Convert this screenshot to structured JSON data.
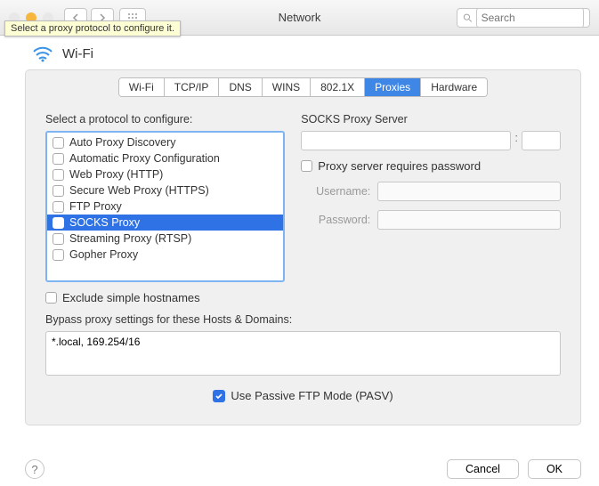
{
  "window": {
    "title": "Network",
    "search_placeholder": "Search",
    "tooltip": "Select a proxy protocol to configure it.",
    "traffic_colors": {
      "close": "#e8e8e8",
      "min": "#f7b63d",
      "max": "#e8e8e8"
    }
  },
  "wifi_header": {
    "label": "Wi-Fi"
  },
  "tabs": [
    "Wi-Fi",
    "TCP/IP",
    "DNS",
    "WINS",
    "802.1X",
    "Proxies",
    "Hardware"
  ],
  "active_tab": "Proxies",
  "left": {
    "label": "Select a protocol to configure:",
    "protocols": [
      {
        "name": "Auto Proxy Discovery",
        "checked": false,
        "selected": false
      },
      {
        "name": "Automatic Proxy Configuration",
        "checked": false,
        "selected": false
      },
      {
        "name": "Web Proxy (HTTP)",
        "checked": false,
        "selected": false
      },
      {
        "name": "Secure Web Proxy (HTTPS)",
        "checked": false,
        "selected": false
      },
      {
        "name": "FTP Proxy",
        "checked": false,
        "selected": false
      },
      {
        "name": "SOCKS Proxy",
        "checked": false,
        "selected": true
      },
      {
        "name": "Streaming Proxy (RTSP)",
        "checked": false,
        "selected": false
      },
      {
        "name": "Gopher Proxy",
        "checked": false,
        "selected": false
      }
    ],
    "exclude_label": "Exclude simple hostnames",
    "exclude_checked": false
  },
  "right": {
    "server_label": "SOCKS Proxy Server",
    "host": "",
    "port": "",
    "requires_password_label": "Proxy server requires password",
    "requires_password": false,
    "username_label": "Username:",
    "username": "",
    "password_label": "Password:",
    "password": ""
  },
  "bypass": {
    "label": "Bypass proxy settings for these Hosts & Domains:",
    "value": "*.local, 169.254/16"
  },
  "pasv": {
    "label": "Use Passive FTP Mode (PASV)",
    "checked": true
  },
  "buttons": {
    "cancel": "Cancel",
    "ok": "OK"
  }
}
